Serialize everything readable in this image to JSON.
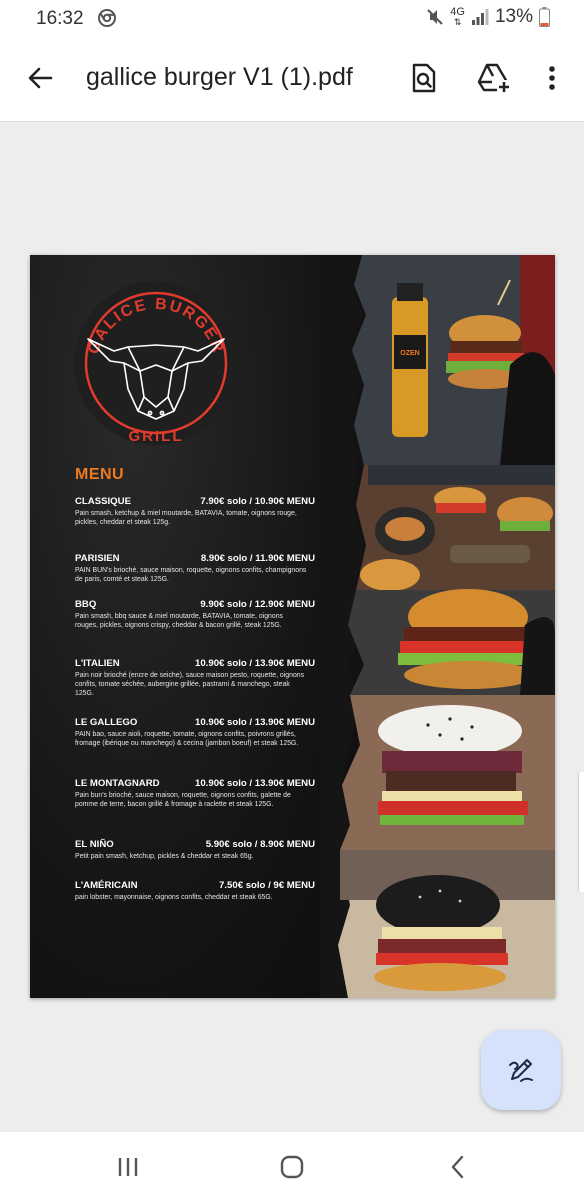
{
  "status_bar": {
    "time": "16:32",
    "network": "4G",
    "battery": "13%",
    "icons": [
      "chrome-icon",
      "mute-icon",
      "signal-icon",
      "battery-icon"
    ]
  },
  "app_bar": {
    "title": "gallice burger V1 (1).pdf",
    "icons": [
      "back-arrow-icon",
      "search-document-icon",
      "drive-add-icon",
      "more-vert-icon"
    ]
  },
  "document": {
    "logo": {
      "top_text": "GALICE BURGER",
      "bottom_text": "GRILL"
    },
    "menu_heading": "MENU",
    "items": [
      {
        "name": "CLASSIQUE",
        "price": "7.90€ solo / 10.90€ MENU",
        "desc": "Pain smash, ketchup & miel moutarde, BATAVIA, tomate, oignons rouge, pickles, cheddar et steak 125g."
      },
      {
        "name": "PARISIEN",
        "price": "8.90€ solo / 11.90€ MENU",
        "desc": "PAIN BUN's brioché, sauce maison, roquette, oignons confits, champignons de paris, comté et steak 125G."
      },
      {
        "name": "BBQ",
        "price": "9.90€ solo / 12.90€ MENU",
        "desc": "Pain smash, bbq sauce & miel moutarde, BATAVIA, tomate, oignons rouges, pickles, oignons crispy, cheddar & bacon grillé, steak 125G."
      },
      {
        "name": "L'ITALIEN",
        "price": "10.90€ solo / 13.90€ MENU",
        "desc": "Pain noir brioché (encre de seiche), sauce maison pesto, roquette, oignons confits, tomate séchée, aubergine grillée, pastrami & manchego, steak 125G."
      },
      {
        "name": "LE GALLEGO",
        "price": "10.90€ solo / 13.90€ MENU",
        "desc": "PAIN bao, sauce aioli, roquette, tomate, oignons confits, poivrons grillés, fromage (ibérique ou manchego) & cecina (jambon boeuf) et steak 125G."
      },
      {
        "name": "LE MONTAGNARD",
        "price": "10.90€ solo / 13.90€ MENU",
        "desc": "Pain bun's brioché, sauce maison, roquette, oignons confits, galette de pomme de terre, bacon grillé & fromage à raclette et steak 125G."
      },
      {
        "name": "EL NIÑO",
        "price": "5.90€ solo / 8.90€ MENU",
        "desc": "Petit pain smash, ketchup, pickles & cheddar et steak 65g."
      },
      {
        "name": "L'AMÉRICAIN",
        "price": "7.50€ solo / 9€ MENU",
        "desc": "pain lobster, mayonnaise, oignons confits, cheddar et steak 65G."
      }
    ],
    "photos": [
      "burger-with-drink-photo",
      "burger-board-photo",
      "burger-closeup-photo",
      "sesame-burger-photo",
      "black-bun-burger-photo"
    ]
  },
  "fab": {
    "icon": "annotate-pen-icon"
  },
  "nav_bar": {
    "icons": [
      "recents-icon",
      "home-icon",
      "back-icon"
    ]
  },
  "colors": {
    "accent_orange": "#f07a1e",
    "logo_red": "#e23b2e",
    "fab_bg": "#d6e2fb"
  }
}
